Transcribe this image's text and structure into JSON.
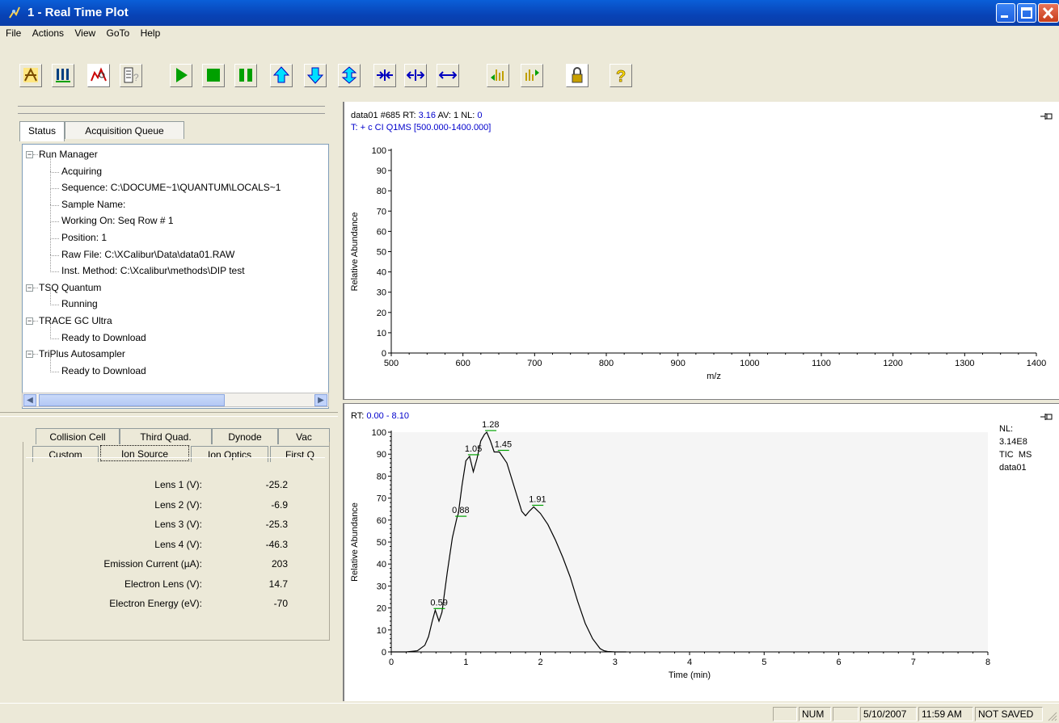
{
  "window": {
    "title": "1 - Real Time Plot"
  },
  "menu": [
    "File",
    "Actions",
    "View",
    "GoTo",
    "Help"
  ],
  "toolbar": {
    "icons": [
      "instrument-setup-icon",
      "sequence-setup-icon",
      "real-time-plot-icon",
      "status-icon",
      "start-icon",
      "stop-icon",
      "pause-icon",
      "scale-up-icon",
      "scale-down-icon",
      "scale-auto-icon",
      "zoom-in-x-icon",
      "zoom-out-x-icon",
      "full-range-x-icon",
      "prev-spectrum-icon",
      "next-spectrum-icon",
      "lock-icon",
      "help-icon"
    ]
  },
  "left": {
    "tabs": [
      "Status",
      "Acquisition Queue"
    ],
    "tree": [
      {
        "label": "Run Manager",
        "level": 0,
        "expanded": true
      },
      {
        "label": "Acquiring",
        "level": 1
      },
      {
        "label": "Sequence: C:\\DOCUME~1\\QUANTUM\\LOCALS~1",
        "level": 1
      },
      {
        "label": "Sample Name:",
        "level": 1
      },
      {
        "label": "Working On: Seq Row # 1",
        "level": 1
      },
      {
        "label": "Position:  1",
        "level": 1
      },
      {
        "label": "Raw File: C:\\XCalibur\\Data\\data01.RAW",
        "level": 1
      },
      {
        "label": "Inst. Method: C:\\Xcalibur\\methods\\DIP test",
        "level": 1
      },
      {
        "label": "TSQ Quantum",
        "level": 0,
        "expanded": true
      },
      {
        "label": "Running",
        "level": 1
      },
      {
        "label": "TRACE GC Ultra",
        "level": 0,
        "expanded": true
      },
      {
        "label": "Ready to Download",
        "level": 1
      },
      {
        "label": "TriPlus Autosampler",
        "level": 0,
        "expanded": true
      },
      {
        "label": "Ready to Download",
        "level": 1
      }
    ],
    "bottom_tabs_row1": [
      "Collision Cell",
      "Third Quad.",
      "Dynode",
      "Vac"
    ],
    "bottom_tabs_row2": [
      "Custom",
      "Ion Source",
      "Ion Optics",
      "First Q"
    ],
    "active_bottom_tab": "Ion Source",
    "params": [
      {
        "label": "Lens 1 (V):",
        "value": "-25.2"
      },
      {
        "label": "Lens 2 (V):",
        "value": "-6.9"
      },
      {
        "label": "Lens 3 (V):",
        "value": "-25.3"
      },
      {
        "label": "Lens 4 (V):",
        "value": "-46.3"
      },
      {
        "label": "Emission Current (µA):",
        "value": "203"
      },
      {
        "label": "Electron Lens (V):",
        "value": "14.7"
      },
      {
        "label": "Electron Energy (eV):",
        "value": "-70"
      }
    ]
  },
  "spectrum": {
    "header_line1_prefix": "data01 #685  RT: ",
    "header_rt": "3.16",
    "header_av": "  AV: 1  NL: ",
    "header_nl": "0",
    "header_line2": "T: + c CI Q1MS [500.000-1400.000]"
  },
  "chromatogram": {
    "header_prefix": "RT: ",
    "header_range": "0.00 - 8.10",
    "legend": [
      "NL:",
      "3.14E8",
      "TIC  MS",
      "data01"
    ]
  },
  "chart_data": [
    {
      "type": "line",
      "title": "",
      "xlabel": "m/z",
      "ylabel": "Relative Abundance",
      "xlim": [
        500,
        1400
      ],
      "ylim": [
        0,
        100
      ],
      "xticks": [
        500,
        600,
        700,
        800,
        900,
        1000,
        1100,
        1200,
        1300,
        1400
      ],
      "yticks": [
        0,
        10,
        20,
        30,
        40,
        50,
        60,
        70,
        80,
        90,
        100
      ],
      "series": []
    },
    {
      "type": "line",
      "title": "",
      "xlabel": "Time (min)",
      "ylabel": "Relative Abundance",
      "xlim": [
        0,
        8
      ],
      "ylim": [
        0,
        100
      ],
      "xticks": [
        0,
        1,
        2,
        3,
        4,
        5,
        6,
        7,
        8
      ],
      "yticks": [
        0,
        10,
        20,
        30,
        40,
        50,
        60,
        70,
        80,
        90,
        100
      ],
      "series": [
        {
          "x": [
            0,
            0.2,
            0.35,
            0.45,
            0.5,
            0.55,
            0.59,
            0.64,
            0.68,
            0.75,
            0.82,
            0.88,
            0.9,
            0.95,
            1.0,
            1.05,
            1.1,
            1.15,
            1.2,
            1.25,
            1.28,
            1.33,
            1.38,
            1.45,
            1.55,
            1.65,
            1.75,
            1.8,
            1.85,
            1.91,
            2.0,
            2.1,
            2.2,
            2.3,
            2.4,
            2.5,
            2.6,
            2.7,
            2.8,
            2.85,
            2.9,
            3.0,
            3.15
          ],
          "y": [
            0,
            0,
            0.5,
            3,
            7,
            14,
            19,
            14,
            18,
            36,
            52,
            61,
            63,
            76,
            87,
            89,
            82,
            88,
            96,
            99,
            100,
            96,
            91,
            91,
            86,
            75,
            64,
            62,
            64,
            66,
            63,
            58,
            51,
            43,
            34,
            23,
            13,
            6,
            1.5,
            0.6,
            0.2,
            0,
            0
          ]
        }
      ],
      "peak_labels": [
        {
          "label": "0.59",
          "x": 0.59,
          "y": 19
        },
        {
          "label": "0.88",
          "x": 0.88,
          "y": 61
        },
        {
          "label": "1.05",
          "x": 1.05,
          "y": 89
        },
        {
          "label": "1.28",
          "x": 1.28,
          "y": 100
        },
        {
          "label": "1.45",
          "x": 1.45,
          "y": 91
        },
        {
          "label": "1.91",
          "x": 1.91,
          "y": 66
        }
      ]
    }
  ],
  "statusbar": {
    "num": "NUM",
    "date": "5/10/2007",
    "time": "11:59 AM",
    "saved": "NOT SAVED"
  },
  "colors": {
    "accent_blue": "#0000cc",
    "peak_marker": "#00a000"
  }
}
